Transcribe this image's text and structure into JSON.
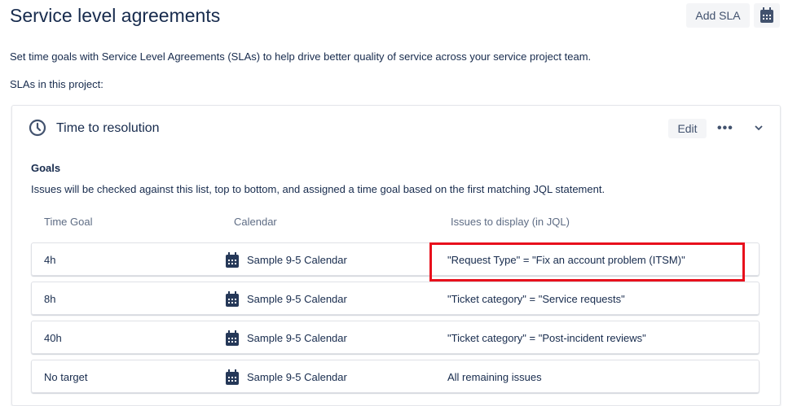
{
  "header": {
    "title": "Service level agreements",
    "add_sla": "Add SLA",
    "calendar_icon": "calendar-icon"
  },
  "description": "Set time goals with Service Level Agreements (SLAs) to help drive better quality of service across your service project team.",
  "slas_label": "SLAs in this project:",
  "sla": {
    "name": "Time to resolution",
    "edit": "Edit",
    "more": "•••",
    "goals_title": "Goals",
    "goals_desc": "Issues will be checked against this list, top to bottom, and assigned a time goal based on the first matching JQL statement.",
    "columns": [
      "Time Goal",
      "Calendar",
      "Issues to display (in JQL)"
    ],
    "rows": [
      {
        "goal": "4h",
        "calendar": "Sample 9-5 Calendar",
        "jql": "\"Request Type\" = \"Fix an account problem (ITSM)\""
      },
      {
        "goal": "8h",
        "calendar": "Sample 9-5 Calendar",
        "jql": "\"Ticket category\" = \"Service requests\""
      },
      {
        "goal": "40h",
        "calendar": "Sample 9-5 Calendar",
        "jql": "\"Ticket category\" = \"Post-incident reviews\""
      },
      {
        "goal": "No target",
        "calendar": "Sample 9-5 Calendar",
        "jql": "All remaining issues"
      }
    ]
  },
  "highlight_color": "#e8101c"
}
